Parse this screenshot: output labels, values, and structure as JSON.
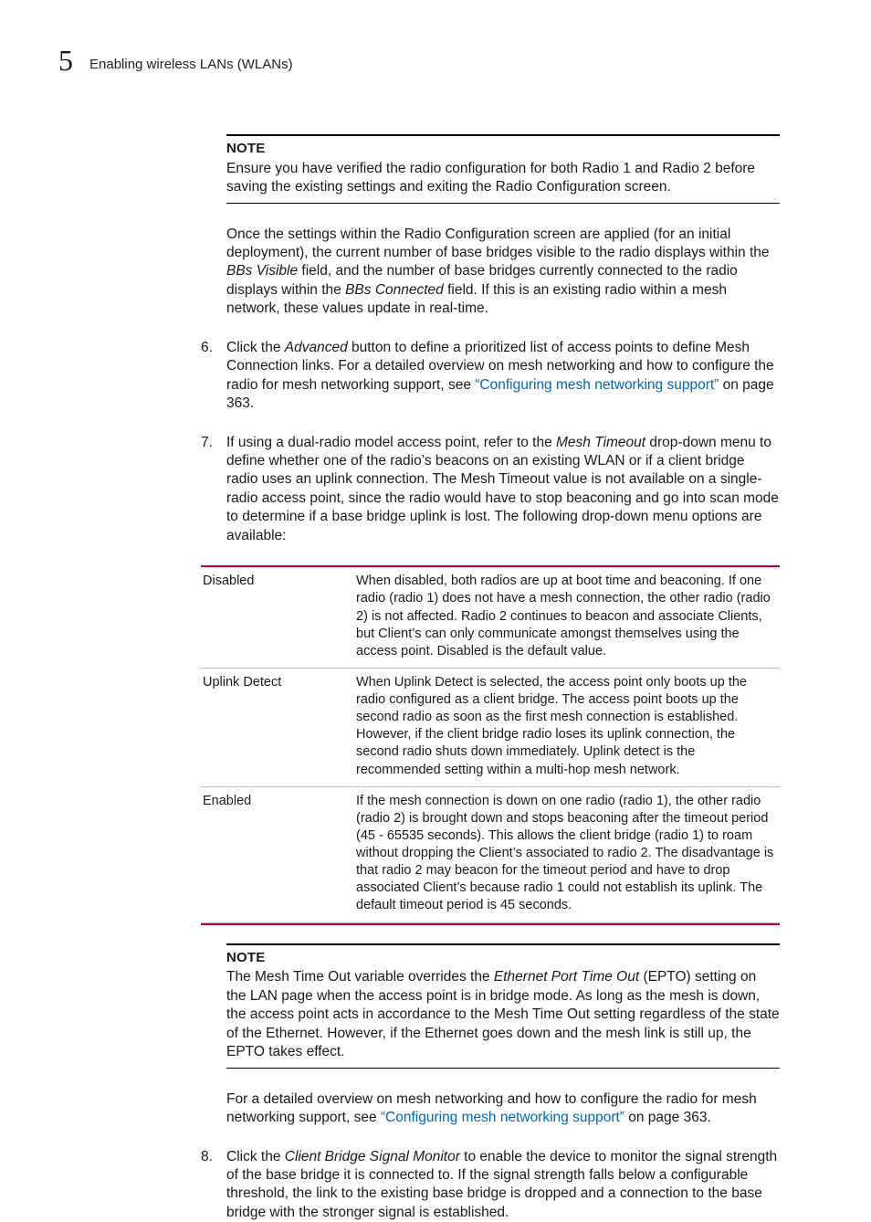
{
  "header": {
    "chapter_number": "5",
    "running_title": "Enabling wireless LANs (WLANs)"
  },
  "note1": {
    "label": "NOTE",
    "text": "Ensure you have verified the radio configuration for both Radio 1 and Radio 2 before saving the existing settings and exiting the Radio Configuration screen."
  },
  "para_intro": {
    "pre": "Once the settings within the Radio Configuration screen are applied (for an initial deployment), the current number of base bridges visible to the radio displays within the ",
    "it1": "BBs Visible",
    "mid1": " field, and the number of base bridges currently connected to the radio displays within the ",
    "it2": "BBs Connected",
    "post": " field. If this is an existing radio within a mesh network, these values update in real-time."
  },
  "step6": {
    "num": "6.",
    "pre": "Click the ",
    "it": "Advanced",
    "mid": " button to define a prioritized list of access points to define Mesh Connection links. For a detailed overview on mesh networking and how to configure the radio for mesh networking support, see ",
    "link": "“Configuring mesh networking support”",
    "post": " on page 363."
  },
  "step7": {
    "num": "7.",
    "pre": "If using a dual-radio model access point, refer to the ",
    "it": "Mesh Timeout",
    "post": " drop-down menu to define whether one of the radio’s beacons on an existing WLAN or if a client bridge radio uses an uplink connection. The Mesh Timeout value is not available on a single-radio access point, since the radio would have to stop beaconing and go into scan mode to determine if a base bridge uplink is lost. The following drop-down menu options are available:"
  },
  "options": [
    {
      "term": "Disabled",
      "desc": "When disabled, both radios are up at boot time and beaconing. If one radio (radio 1) does not have a mesh connection, the other radio (radio 2) is not affected. Radio 2 continues to beacon and associate Clients, but Client’s can only communicate amongst themselves using the access point. Disabled is the default value."
    },
    {
      "term": "Uplink Detect",
      "desc": "When Uplink Detect is selected, the access point only boots up the radio configured as a client bridge. The access point boots up the second radio as soon as the first mesh connection is established. However, if the client bridge radio loses its uplink connection, the second radio shuts down immediately. Uplink detect is the recommended setting within a multi-hop mesh network."
    },
    {
      "term": "Enabled",
      "desc": "If the mesh connection is down on one radio (radio 1), the other radio (radio 2) is brought down and stops beaconing after the timeout period (45 - 65535 seconds). This allows the client bridge (radio 1) to roam without dropping the Client’s associated to radio 2. The disadvantage is that radio 2 may beacon for the timeout period and have to drop associated Client’s because radio 1 could not establish its uplink. The default timeout period is 45 seconds."
    }
  ],
  "note2": {
    "label": "NOTE",
    "pre": "The Mesh Time Out variable overrides the ",
    "it": "Ethernet Port Time Out",
    "post": " (EPTO) setting on the LAN page when the access point is in bridge mode. As long as the mesh is down, the access point acts in accordance to the Mesh Time Out setting regardless of the state of the Ethernet. However, if the Ethernet goes down and the mesh link is still up, the EPTO takes effect."
  },
  "para_after_note2": {
    "pre": "For a detailed overview on mesh networking and how to configure the radio for mesh networking support, see ",
    "link": "“Configuring mesh networking support”",
    "post": " on page 363."
  },
  "step8": {
    "num": "8.",
    "pre": "Click the ",
    "it": "Client Bridge Signal Monitor",
    "post": " to enable the device to monitor the signal strength of the base bridge it is connected to. If the signal strength falls below a configurable threshold, the link to the existing base bridge is dropped and a connection to the base bridge with the stronger signal is established."
  }
}
